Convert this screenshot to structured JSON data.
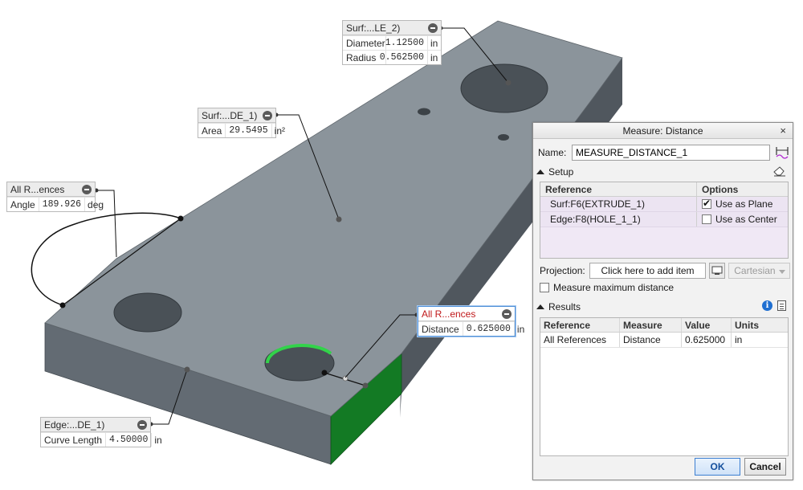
{
  "colors": {
    "part_top": "#8b949b",
    "part_side": "#596068",
    "part_front": "#636b73",
    "selected_surface": "#137a24",
    "selected_edge": "#32d34a"
  },
  "callouts": {
    "hole2": {
      "title": "Surf:...LE_2)",
      "rows": [
        {
          "label": "Diameter",
          "value": "1.12500",
          "unit": "in"
        },
        {
          "label": "Radius",
          "value": "0.562500",
          "unit": "in"
        }
      ]
    },
    "surf": {
      "title": "Surf:...DE_1)",
      "label": "Area",
      "value": "29.5495",
      "unit": "in²"
    },
    "angle": {
      "title": "All R...ences",
      "label": "Angle",
      "value": "189.926",
      "unit": "deg"
    },
    "distance": {
      "title": "All R...ences",
      "label": "Distance",
      "value": "0.625000",
      "unit": "in"
    },
    "edge": {
      "title": "Edge:...DE_1)",
      "label": "Curve Length",
      "value": "4.50000",
      "unit": "in"
    }
  },
  "dialog": {
    "title": "Measure: Distance",
    "close_glyph": "×",
    "name_label": "Name:",
    "name_value": "MEASURE_DISTANCE_1",
    "setup_label": "Setup",
    "ref_headers": {
      "reference": "Reference",
      "options": "Options"
    },
    "references": [
      {
        "reference": "Surf:F6(EXTRUDE_1)",
        "option": "Use as Plane",
        "checked": true
      },
      {
        "reference": "Edge:F8(HOLE_1_1)",
        "option": "Use as Center",
        "checked": false
      }
    ],
    "projection_label": "Projection:",
    "projection_button": "Click here to add item",
    "projection_select": "Cartesian",
    "max_distance_label": "Measure maximum distance",
    "results_label": "Results",
    "result_headers": {
      "reference": "Reference",
      "measure": "Measure",
      "value": "Value",
      "units": "Units"
    },
    "results": [
      {
        "reference": "All References",
        "measure": "Distance",
        "value": "0.625000",
        "units": "in"
      }
    ],
    "ok_label": "OK",
    "cancel_label": "Cancel"
  }
}
